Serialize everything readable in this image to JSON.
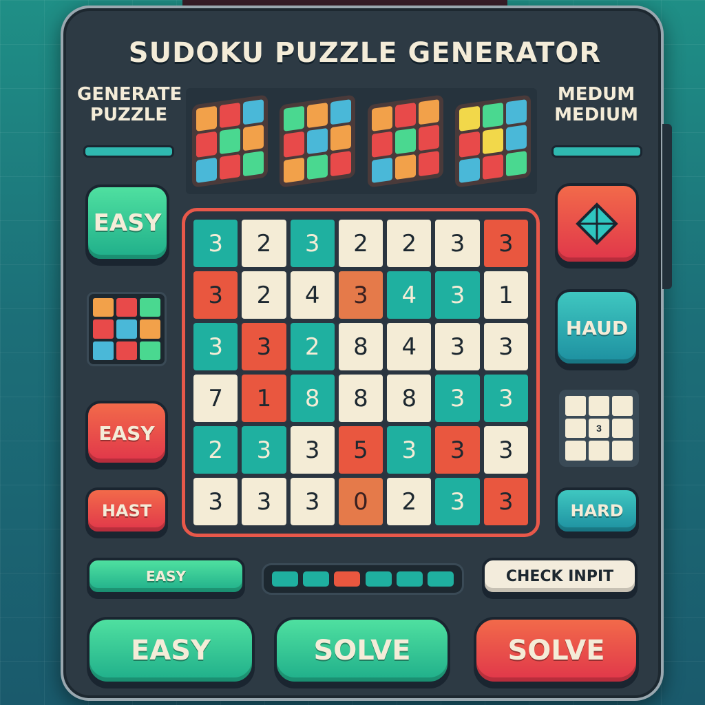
{
  "title": "SUDOKU PUZZLE GENERATOR",
  "left_label": {
    "line1": "GENERATE",
    "line2": "PUZZLE"
  },
  "right_label": {
    "line1": "MEDUM",
    "line2": "MEDIUM"
  },
  "colors": {
    "teal": "#1fb0a0",
    "red": "#e9573f",
    "cream": "#f4ecd6",
    "frame": "#2d3a44"
  },
  "left_buttons": {
    "easy_top": "EASY",
    "easy_mid": "EASY",
    "hast": "HAST"
  },
  "right_buttons": {
    "shape_icon": "diamond-icon",
    "hard_mid": "HAUD",
    "hard_low": "HARD"
  },
  "right_mini_grid": {
    "value": "3"
  },
  "board": {
    "rows": [
      [
        {
          "v": "3",
          "c": "teal"
        },
        {
          "v": "2",
          "c": "cream"
        },
        {
          "v": "3",
          "c": "teal"
        },
        {
          "v": "2",
          "c": "cream"
        },
        {
          "v": "2",
          "c": "cream"
        },
        {
          "v": "3",
          "c": "cream"
        },
        {
          "v": "3",
          "c": "red"
        }
      ],
      [
        {
          "v": "3",
          "c": "red"
        },
        {
          "v": "2",
          "c": "cream"
        },
        {
          "v": "4",
          "c": "cream"
        },
        {
          "v": "3",
          "c": "faded"
        },
        {
          "v": "4",
          "c": "teal"
        },
        {
          "v": "3",
          "c": "teal"
        },
        {
          "v": "1",
          "c": "cream"
        }
      ],
      [
        {
          "v": "3",
          "c": "teal"
        },
        {
          "v": "3",
          "c": "red"
        },
        {
          "v": "2",
          "c": "teal"
        },
        {
          "v": "8",
          "c": "cream"
        },
        {
          "v": "4",
          "c": "cream"
        },
        {
          "v": "3",
          "c": "cream"
        },
        {
          "v": "3",
          "c": "cream"
        }
      ],
      [
        {
          "v": "7",
          "c": "cream"
        },
        {
          "v": "1",
          "c": "red"
        },
        {
          "v": "8",
          "c": "teal"
        },
        {
          "v": "8",
          "c": "cream"
        },
        {
          "v": "8",
          "c": "cream"
        },
        {
          "v": "3",
          "c": "teal"
        },
        {
          "v": "3",
          "c": "teal"
        }
      ],
      [
        {
          "v": "2",
          "c": "teal"
        },
        {
          "v": "3",
          "c": "teal"
        },
        {
          "v": "3",
          "c": "cream"
        },
        {
          "v": "5",
          "c": "red"
        },
        {
          "v": "3",
          "c": "teal"
        },
        {
          "v": "3",
          "c": "red"
        },
        {
          "v": "3",
          "c": "cream"
        }
      ],
      [
        {
          "v": "3",
          "c": "cream"
        },
        {
          "v": "3",
          "c": "cream"
        },
        {
          "v": "3",
          "c": "cream"
        },
        {
          "v": "0",
          "c": "faded"
        },
        {
          "v": "2",
          "c": "cream"
        },
        {
          "v": "3",
          "c": "teal"
        },
        {
          "v": "3",
          "c": "red"
        }
      ]
    ]
  },
  "bottom_row": {
    "easy_bar": "EASY",
    "check_input": "CHECK INPIT"
  },
  "progress_segments": [
    "teal",
    "teal",
    "red",
    "teal",
    "teal",
    "teal"
  ],
  "actions": {
    "easy": "EASY",
    "solve_teal": "SOLVE",
    "solve_red": "SOLVE"
  }
}
